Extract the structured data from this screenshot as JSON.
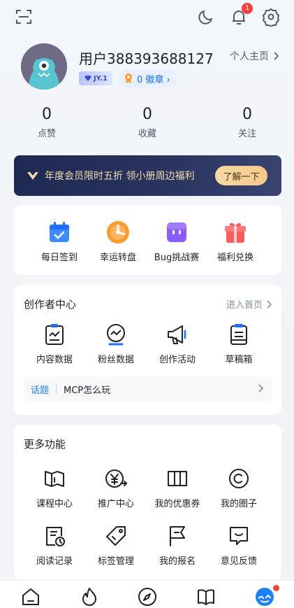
{
  "profile": {
    "username": "用户388393688127",
    "homepage_label": "个人主页",
    "level_label": "JY.1",
    "medal_label": "0 徽章 ›"
  },
  "notifications": {
    "count": "1"
  },
  "stats": [
    {
      "value": "0",
      "label": "点赞"
    },
    {
      "value": "0",
      "label": "收藏"
    },
    {
      "value": "0",
      "label": "关注"
    }
  ],
  "vip": {
    "text": "年度会员限时五折 领小册周边福利",
    "button": "了解一下"
  },
  "quick_actions": [
    {
      "label": "每日签到",
      "icon": "calendar-check-icon"
    },
    {
      "label": "幸运转盘",
      "icon": "lucky-wheel-icon"
    },
    {
      "label": "Bug挑战赛",
      "icon": "bug-robot-icon"
    },
    {
      "label": "福利兑换",
      "icon": "gift-box-icon"
    }
  ],
  "creator": {
    "title": "创作者中心",
    "link": "进入首页",
    "items": [
      {
        "label": "内容数据",
        "icon": "content-data-icon"
      },
      {
        "label": "粉丝数据",
        "icon": "fans-data-icon"
      },
      {
        "label": "创作活动",
        "icon": "megaphone-icon"
      },
      {
        "label": "草稿箱",
        "icon": "draft-box-icon"
      }
    ],
    "topic_tag": "话题",
    "topic_text": "MCP怎么玩"
  },
  "more": {
    "title": "更多功能",
    "items": [
      {
        "label": "课程中心",
        "icon": "book-icon"
      },
      {
        "label": "推广中心",
        "icon": "yen-promotion-icon"
      },
      {
        "label": "我的优惠券",
        "icon": "coupon-icon"
      },
      {
        "label": "我的圈子",
        "icon": "circle-icon"
      },
      {
        "label": "阅读记录",
        "icon": "reading-history-icon"
      },
      {
        "label": "标签管理",
        "icon": "tag-icon"
      },
      {
        "label": "我的报名",
        "icon": "flag-icon"
      },
      {
        "label": "意见反馈",
        "icon": "feedback-icon"
      }
    ]
  },
  "colors": {
    "accent": "#1e80ff",
    "vip_gold": "#f6dcae",
    "badge_red": "#f53f3f"
  }
}
